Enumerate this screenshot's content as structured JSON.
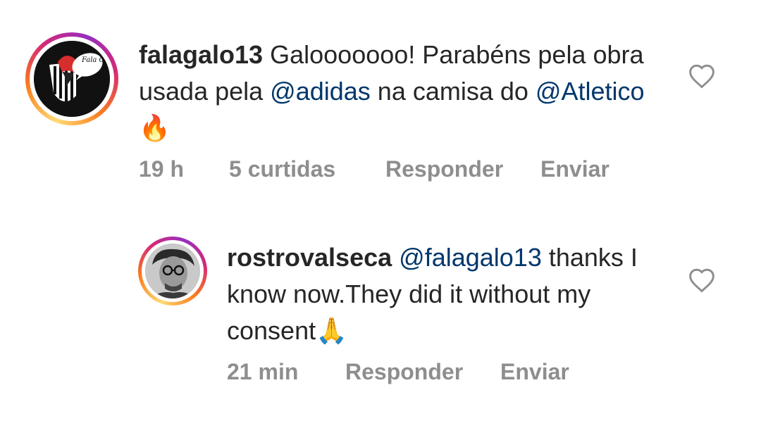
{
  "comments": [
    {
      "username": "falagalo13",
      "avatar_text": "Fala Galo",
      "text_parts": [
        "Galooooooo! Parabéns pela obra usada pela ",
        "@adidas",
        " na camisa do ",
        "@Atletico",
        " 🔥"
      ],
      "time": "19 h",
      "likes": "5 curtidas",
      "reply_label": "Responder",
      "send_label": "Enviar"
    },
    {
      "username": "rostrovalseca",
      "text_parts": [
        "@falagalo13",
        " thanks I know now.They did it without my consent🙏"
      ],
      "time": "21 min",
      "reply_label": "Responder",
      "send_label": "Enviar"
    }
  ]
}
